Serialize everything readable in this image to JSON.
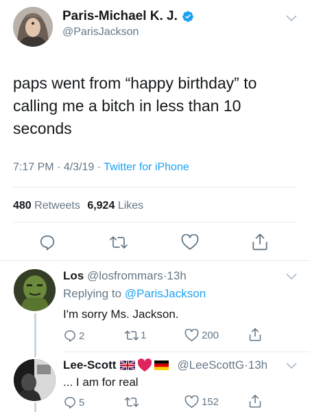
{
  "main_tweet": {
    "display_name": "Paris-Michael K. J.",
    "handle": "@ParisJackson",
    "text_lines": [
      "paps went from “happy birthday” to",
      "calling me a bitch in less than 10",
      "seconds"
    ],
    "time": "7:17 PM",
    "date": "4/3/19",
    "client": "Twitter for iPhone",
    "retweets_count": "480",
    "retweets_label": "Retweets",
    "likes_count": "6,924",
    "likes_label": "Likes",
    "sep": "·"
  },
  "replies": [
    {
      "display_name": "Los",
      "handle": "@losfrommars",
      "time": "13h",
      "replying_prefix": "Replying to",
      "replying_to": "@ParisJackson",
      "text": "I'm sorry Ms. Jackson.",
      "reply_count": "2",
      "retweet_count": "1",
      "like_count": "200"
    },
    {
      "display_name": "Lee-Scott",
      "handle": "@LeeScottG",
      "time": "13h",
      "text": "... I am for real",
      "reply_count": "5",
      "retweet_count": "",
      "like_count": "152"
    }
  ],
  "colors": {
    "accent": "#1da1f2",
    "muted": "#657786",
    "text": "#14171a",
    "divider": "#e6ecf0"
  }
}
